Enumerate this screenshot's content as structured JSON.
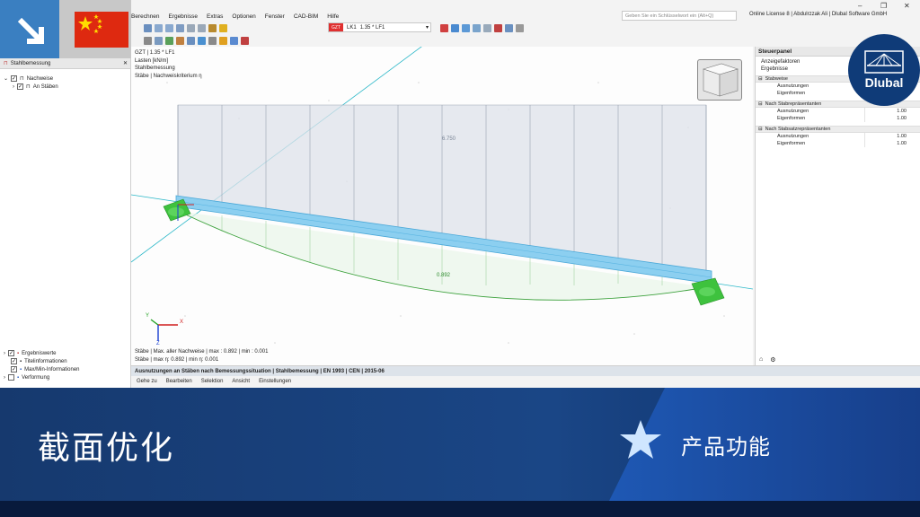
{
  "menu": [
    "Berechnen",
    "Ergebnisse",
    "Extras",
    "Optionen",
    "Fenster",
    "CAD-BIM",
    "Hilfe"
  ],
  "search": {
    "placeholder": "Geben Sie ein Schlüsselwort ein (Alt+Q)"
  },
  "license": "Online License 8 | Abdulrzzak Ali | Dlubal Software GmbH",
  "loadcase": {
    "tag": "GZT",
    "id": "LK1",
    "label": "1.35 * LF1"
  },
  "left_panel": {
    "title": "Stahlbemessung",
    "tree": [
      {
        "label": "Nachweise",
        "checked": true,
        "level": 0
      },
      {
        "label": "An Stäben",
        "checked": true,
        "level": 1
      }
    ],
    "bottom_tree": [
      {
        "label": "Ergebniswerte",
        "checked": true
      },
      {
        "label": "Titelinformationen",
        "checked": true
      },
      {
        "label": "Max/Min-Informationen",
        "checked": true
      },
      {
        "label": "Verformung",
        "checked": false
      }
    ]
  },
  "viewport": {
    "info_lines": [
      "GZT | 1.35 * LF1",
      "Lasten [kN/m]",
      "Stahlbemessung",
      "Stäbe | Nachweiskriterium η"
    ],
    "bottom_lines": [
      "Stäbe | Max. aller Nachweise | max : 0.892 | min : 0.001",
      "Stäbe | max η: 0.892 | min η: 0.001"
    ],
    "load_value": "6.750",
    "result_value": "0.892",
    "axis_labels": {
      "x": "X",
      "y": "Y",
      "z": "Z"
    }
  },
  "right_panel": {
    "title": "Steuerpanel",
    "sub": [
      "Anzeigefaktoren",
      "Ergebnisse"
    ],
    "sections": [
      {
        "title": "Stabweise",
        "rows": [
          {
            "k": "Ausnutzungen",
            "v": ""
          },
          {
            "k": "Eigenformen",
            "v": ""
          }
        ]
      },
      {
        "title": "Nach Stabrepräsentanten",
        "rows": [
          {
            "k": "Ausnutzungen",
            "v": "1.00"
          },
          {
            "k": "Eigenformen",
            "v": "1.00"
          }
        ]
      },
      {
        "title": "Nach Stabsatzrepräsentanten",
        "rows": [
          {
            "k": "Ausnutzungen",
            "v": "1.00"
          },
          {
            "k": "Eigenformen",
            "v": "1.00"
          }
        ]
      }
    ]
  },
  "bottom_panel": {
    "title": "Ausnutzungen an Stäben nach Bemessungssituation | Stahlbemessung | EN 1993 | CEN | 2015-06",
    "menu": [
      "Gehe zu",
      "Bearbeiten",
      "Selektion",
      "Ansicht",
      "Einstellungen"
    ]
  },
  "logo": {
    "text": "Dlubal"
  },
  "banner": {
    "title": "截面优化",
    "subtitle": "产品功能"
  },
  "colors": {
    "corner_blue": "#3a7fc1",
    "banner": "#1a4686",
    "beam": "#8ccff0",
    "support": "#3ec23e",
    "result_line": "#3aa03a"
  }
}
